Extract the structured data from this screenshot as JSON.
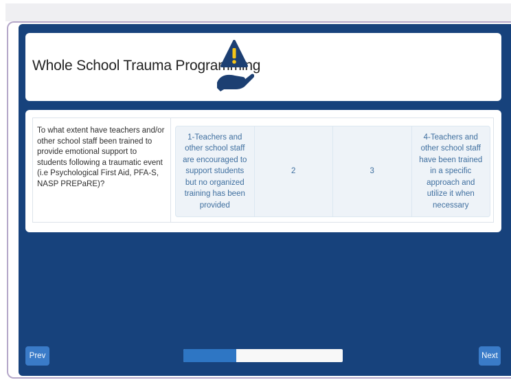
{
  "header": {
    "title": "Whole School Trauma Programming",
    "icon": "hand-holding-warning-icon"
  },
  "question": {
    "text": "To what extent have teachers and/or other school staff been trained to provide emotional support to students following a traumatic event (i.e Psychological First Aid, PFA-S, NASP PREPaRE)?"
  },
  "options": [
    "1-Teachers and other school staff are encouraged to support students but no organized training has been provided",
    "2",
    "3",
    "4-Teachers and other school staff have been trained in a specific approach and utilize it when necessary"
  ],
  "navigation": {
    "prev_label": "Prev",
    "next_label": "Next"
  },
  "progress": {
    "fraction": 0.33
  },
  "colors": {
    "panel": "#17427c",
    "accent": "#3a7bc8",
    "option_text": "#3f6f9f",
    "option_bg": "#eef3f8",
    "warning": "#f5c518",
    "icon_blue": "#1c3f72"
  }
}
